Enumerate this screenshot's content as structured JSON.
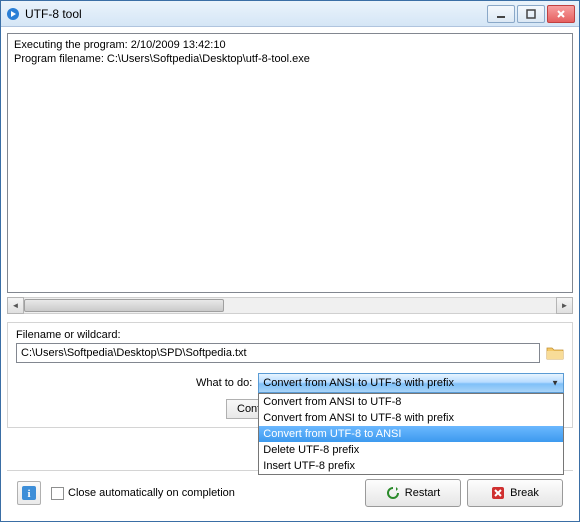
{
  "window": {
    "title": "UTF-8 tool"
  },
  "log": {
    "line1": "Executing the program:  2/10/2009 13:42:10",
    "line2": "Program filename: C:\\Users\\Softpedia\\Desktop\\utf-8-tool.exe"
  },
  "file": {
    "label": "Filename or wildcard:",
    "value": "C:\\Users\\Softpedia\\Desktop\\SPD\\Softpedia.txt"
  },
  "what": {
    "label": "What to do:",
    "selected": "Convert from ANSI to UTF-8 with prefix",
    "options": [
      "Convert from ANSI to UTF-8",
      "Convert from ANSI to UTF-8 with prefix",
      "Convert from UTF-8 to ANSI",
      "Delete UTF-8 prefix",
      "Insert UTF-8 prefix"
    ],
    "highlighted_index": 2
  },
  "buttons": {
    "continue": "Conti",
    "close_auto": "Close automatically on completion",
    "restart": "Restart",
    "break": "Break"
  }
}
